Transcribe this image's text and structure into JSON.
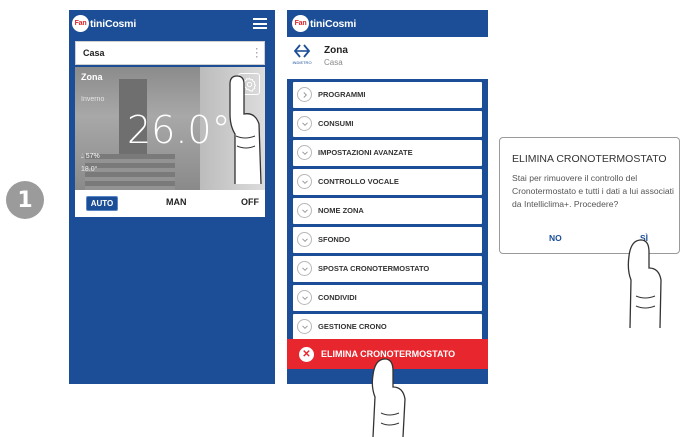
{
  "step": {
    "number": "1"
  },
  "brand": {
    "logo_mark": "Fan",
    "logo_text": "tiniCosmi",
    "red": "#d9262b",
    "blue": "#1b4e96"
  },
  "screen1": {
    "location": "Casa",
    "zone": {
      "name": "Zona",
      "mode": "Inverno",
      "temperature": "26.0°",
      "humidity": "57%",
      "setpoint": "18.0°"
    },
    "icons": [
      "menu-icon",
      "kebab-icon",
      "gear-icon",
      "humidity-drop-icon"
    ],
    "modes": {
      "auto": "AUTO",
      "man": "MAN",
      "off": "OFF",
      "selected": "AUTO"
    }
  },
  "screen2": {
    "back_label": "INDIETRO",
    "title": "Zona",
    "subtitle": "Casa",
    "menu": [
      {
        "label": "PROGRAMMI",
        "icon": "chevron-right-icon"
      },
      {
        "label": "CONSUMI",
        "icon": "chevron-down-icon"
      },
      {
        "label": "IMPOSTAZIONI AVANZATE",
        "icon": "chevron-down-icon"
      },
      {
        "label": "CONTROLLO VOCALE",
        "icon": "chevron-down-icon"
      },
      {
        "label": "NOME ZONA",
        "icon": "chevron-down-icon"
      },
      {
        "label": "SFONDO",
        "icon": "chevron-down-icon"
      },
      {
        "label": "SPOSTA CRONOTERMOSTATO",
        "icon": "chevron-down-icon"
      },
      {
        "label": "CONDIVIDI",
        "icon": "chevron-down-icon"
      },
      {
        "label": "GESTIONE CRONO",
        "icon": "chevron-down-icon"
      }
    ],
    "delete_label": "ELIMINA CRONOTERMOSTATO",
    "delete_color": "#e8262d"
  },
  "dialog": {
    "title": "ELIMINA CRONOTERMOSTATO",
    "body": "Stai per rimuovere il controllo del Cronotermostato e tutti i dati a lui associati da Intelliclima+. Procedere?",
    "no_label": "NO",
    "yes_label": "SÌ"
  }
}
